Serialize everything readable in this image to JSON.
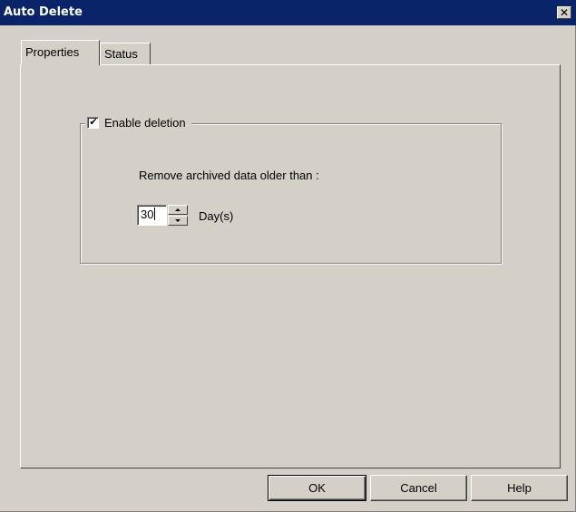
{
  "window": {
    "title": "Auto Delete",
    "close_glyph": "✕"
  },
  "tabs": [
    {
      "label": "Properties",
      "selected": true
    },
    {
      "label": "Status",
      "selected": false
    }
  ],
  "group": {
    "checkbox_label": "Enable deletion",
    "checked": true,
    "check_glyph": "✔"
  },
  "retention": {
    "label": "Remove archived data older than :",
    "value": "30",
    "unit": "Day(s)"
  },
  "buttons": {
    "ok": "OK",
    "cancel": "Cancel",
    "help": "Help"
  },
  "colors": {
    "titlebar": "#0a246a",
    "face": "#d4d0c8"
  },
  "icons": {
    "close": "close-icon",
    "check": "checkmark-icon",
    "spin_up": "arrow-up-icon",
    "spin_down": "arrow-down-icon"
  }
}
